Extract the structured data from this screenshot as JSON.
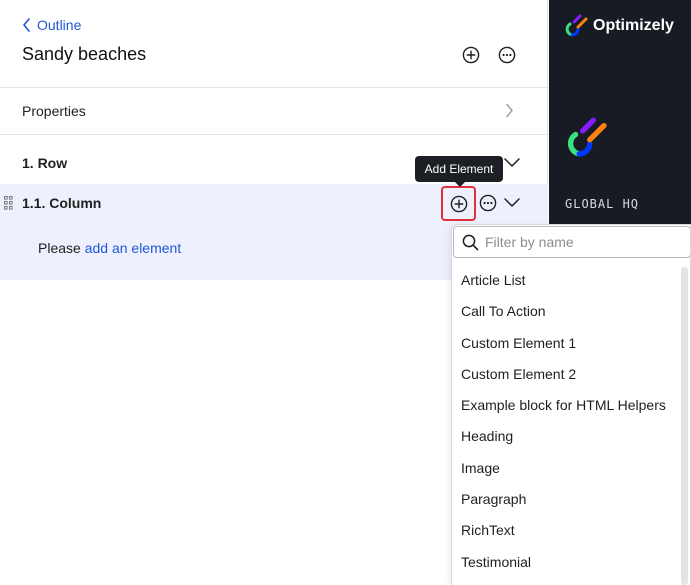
{
  "header": {
    "back_label": "Outline",
    "title": "Sandy beaches"
  },
  "properties": {
    "label": "Properties"
  },
  "tree": {
    "row_label": "1. Row",
    "column_label": "1.1. Column",
    "empty_prefix": "Please ",
    "empty_link": "add an element"
  },
  "tooltip": {
    "text": "Add Element"
  },
  "brand": {
    "name": "Optimizely",
    "site": "GLOBAL HQ"
  },
  "element_picker": {
    "filter_placeholder": "Filter by name",
    "filter_value": "",
    "options": [
      "Article List",
      "Call To Action",
      "Custom Element 1",
      "Custom Element 2",
      "Example block for HTML Helpers",
      "Heading",
      "Image",
      "Paragraph",
      "RichText",
      "Testimonial"
    ]
  },
  "colors": {
    "link": "#2157d6",
    "highlight_bg": "#eef1fd",
    "focus_ring": "#e0303a",
    "brand_bg": "#171b24"
  }
}
